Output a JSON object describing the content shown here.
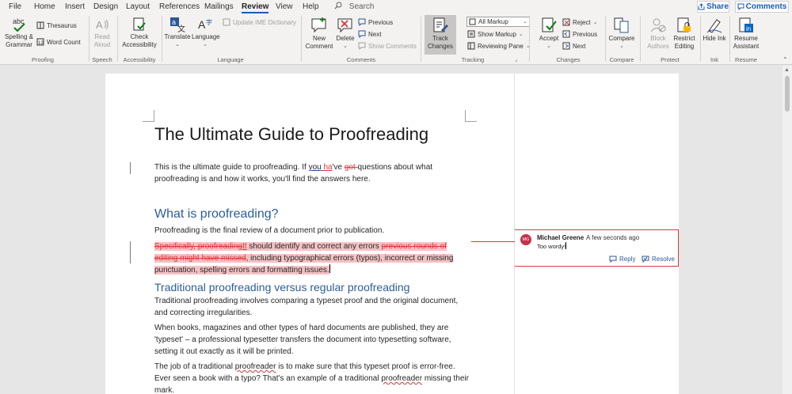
{
  "menu": {
    "items": [
      "File",
      "Home",
      "Insert",
      "Design",
      "Layout",
      "References",
      "Mailings",
      "Review",
      "View",
      "Help"
    ],
    "active": "Review",
    "search_placeholder": "Search",
    "share_label": "Share",
    "comments_label": "Comments"
  },
  "ribbon": {
    "proofing": {
      "spelling": "Spelling & Grammar",
      "thesaurus": "Thesaurus",
      "word_count": "Word Count",
      "label": "Proofing"
    },
    "speech": {
      "read_aloud": "Read Aloud",
      "label": "Speech"
    },
    "accessibility": {
      "check": "Check Accessibility",
      "label": "Accessibility"
    },
    "language": {
      "translate": "Translate",
      "language": "Language",
      "ime": "Update IME Dictionary",
      "label": "Language"
    },
    "comments": {
      "new": "New Comment",
      "delete": "Delete",
      "previous": "Previous",
      "next": "Next",
      "show": "Show Comments",
      "label": "Comments"
    },
    "tracking": {
      "track": "Track Changes",
      "markup_value": "All Markup",
      "show_markup": "Show Markup",
      "reviewing_pane": "Reviewing Pane",
      "label": "Tracking"
    },
    "changes": {
      "accept": "Accept",
      "reject": "Reject",
      "previous": "Previous",
      "next": "Next",
      "label": "Changes"
    },
    "compare": {
      "compare": "Compare",
      "label": "Compare"
    },
    "protect": {
      "block": "Block Authors",
      "restrict": "Restrict Editing",
      "label": "Protect"
    },
    "ink": {
      "hide": "Hide Ink",
      "label": "Ink"
    },
    "resume": {
      "assistant": "Resume Assistant",
      "label": "Resume"
    }
  },
  "document": {
    "title": "The Ultimate Guide to Proofreading",
    "intro": {
      "before": "This is the ultimate guide to proofreading.  If ",
      "you": "you",
      "ins": " ha",
      "apos": "'ve ",
      "del": "got ",
      "after": "questions about what proofreading is and how it works, you'll find the answers here."
    },
    "h1": "What is proofreading?",
    "p1": "Proofreading is the final review of a document prior to publication.",
    "p2": {
      "del1": "Specifically, proofreading",
      "ins1": "It",
      "mid": " should identify and correct any errors ",
      "del2": "previous rounds of editing might have missed",
      "after": ", including typographical errors (typos), incorrect or missing punctuation, spelling errors and formatting issues."
    },
    "h2": "Traditional proofreading versus regular proofreading",
    "p3": "Traditional proofreading involves comparing a typeset proof and the original document, and correcting irregularities.",
    "p4": "When books, magazines and other types of hard documents are published, they are 'typeset' – a professional typesetter transfers the document into typesetting software, setting it out exactly as it will be printed.",
    "p5": {
      "a": "The job of a traditional ",
      "b": "proofreader",
      "c": " is to make sure that this typeset proof is error-free. Ever seen a book with a typo?  That's an example of a traditional ",
      "d": "proofreader",
      "e": " missing their mark."
    }
  },
  "comment": {
    "initials": "MG",
    "author": "Michael Greene",
    "time": "A few seconds ago",
    "text": "Too wordy!",
    "reply": "Reply",
    "resolve": "Resolve"
  },
  "colors": {
    "accent": "#185abd",
    "revision": "#e0373a",
    "heading": "#2e5d97"
  }
}
